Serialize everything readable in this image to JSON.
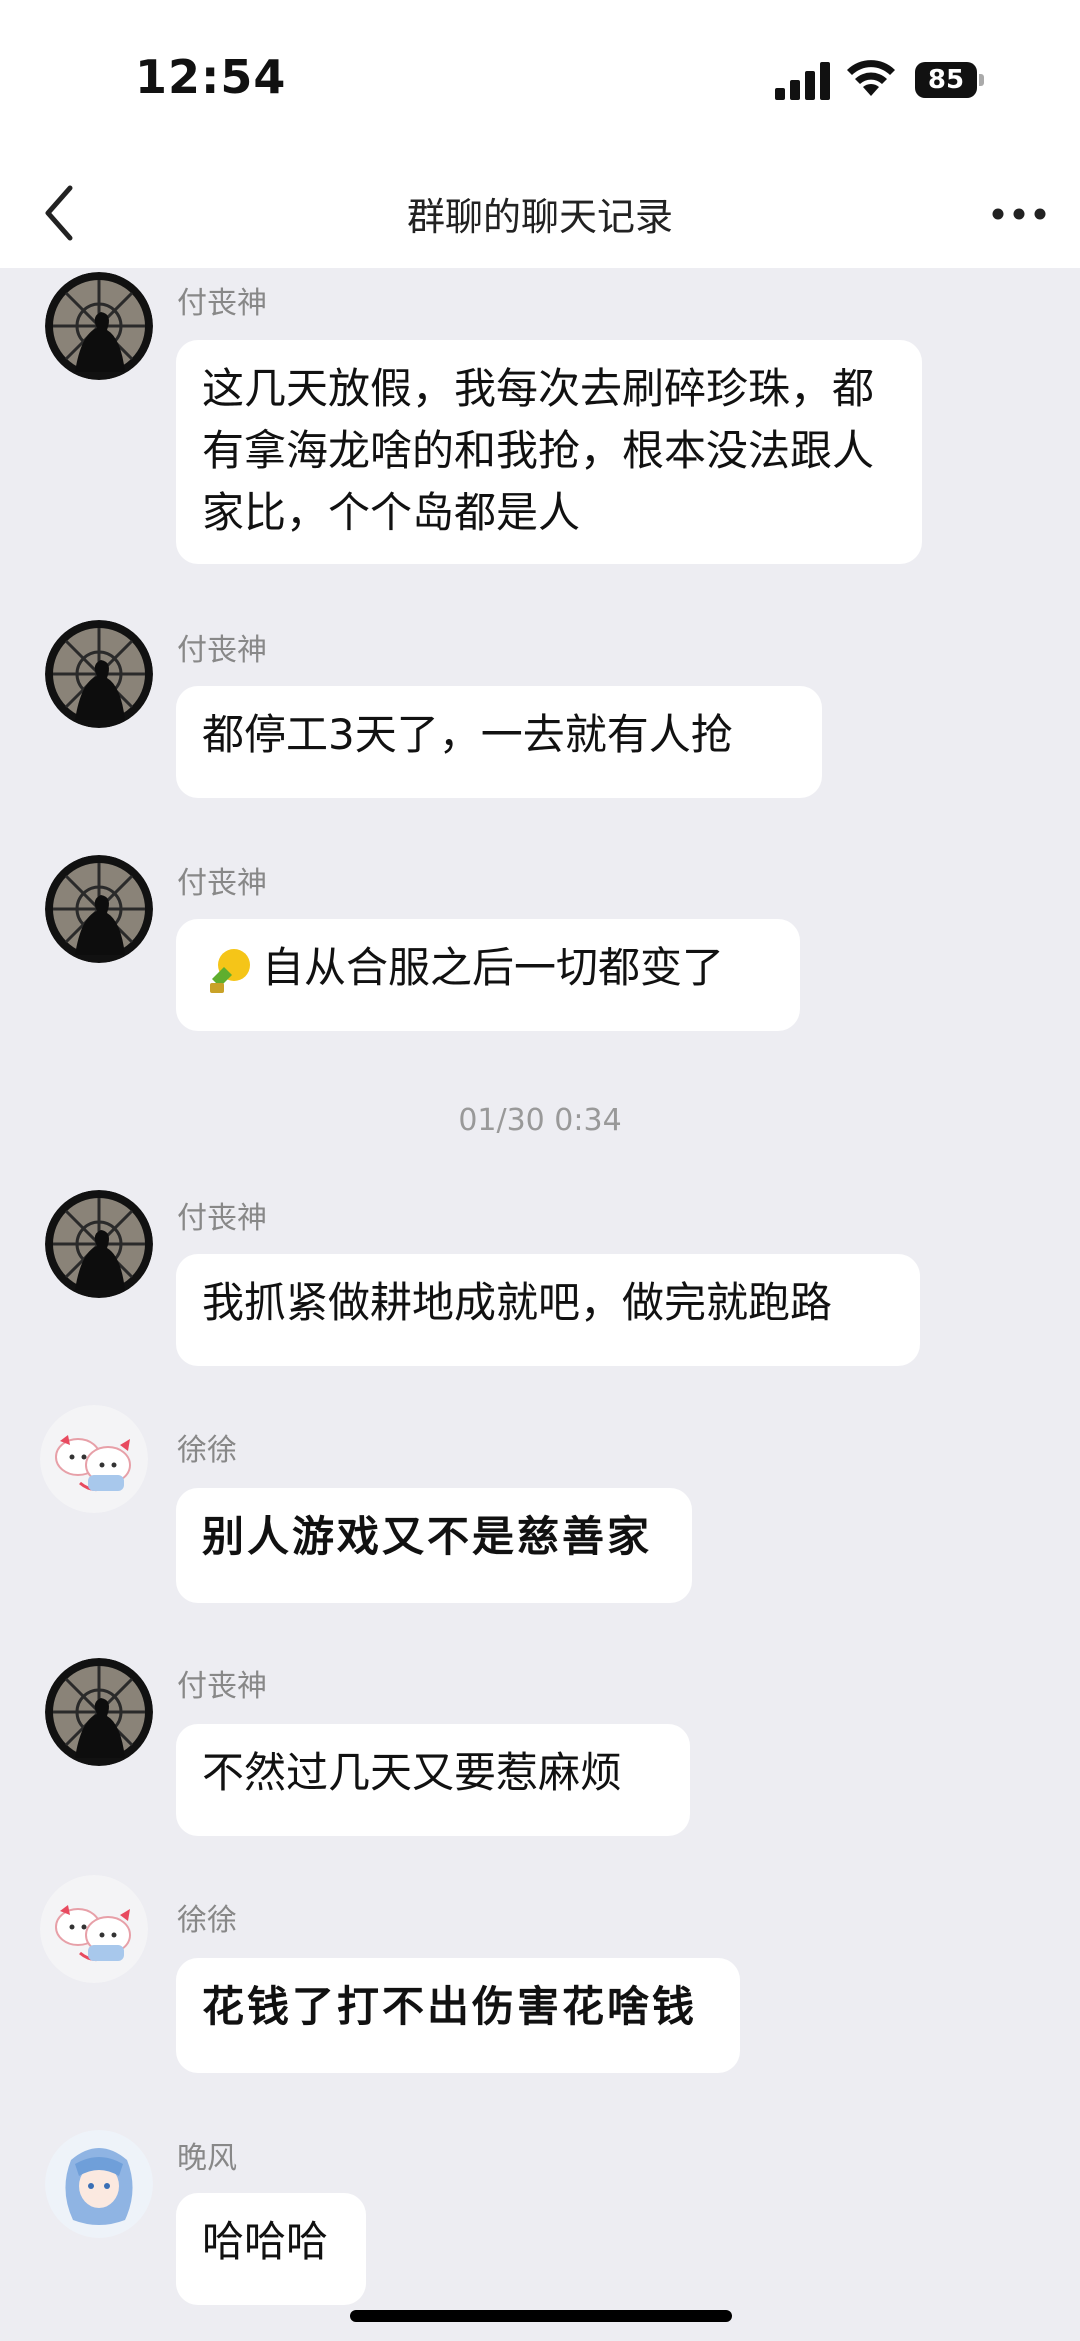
{
  "status_bar": {
    "time": "12:54",
    "battery": "85"
  },
  "header": {
    "title": "群聊的聊天记录"
  },
  "timestamp": "01/30 0:34",
  "messages": [
    {
      "sender": "付丧神",
      "text": "这几天放假，我每次去刷碎珍珠，都有拿海龙啥的和我抢，根本没法跟人家比，个个岛都是人"
    },
    {
      "sender": "付丧神",
      "text": "都停工3天了，一去就有人抢"
    },
    {
      "sender": "付丧神",
      "text": "自从合服之后一切都变了",
      "emoji": "lightbulb-sticker"
    },
    {
      "sender": "付丧神",
      "text": "我抓紧做耕地成就吧，做完就跑路"
    },
    {
      "sender": "徐徐",
      "text": "别人游戏又不是慈善家"
    },
    {
      "sender": "付丧神",
      "text": "不然过几天又要惹麻烦"
    },
    {
      "sender": "徐徐",
      "text": "花钱了打不出伤害花啥钱"
    },
    {
      "sender": "晚风",
      "text": "哈哈哈"
    }
  ]
}
